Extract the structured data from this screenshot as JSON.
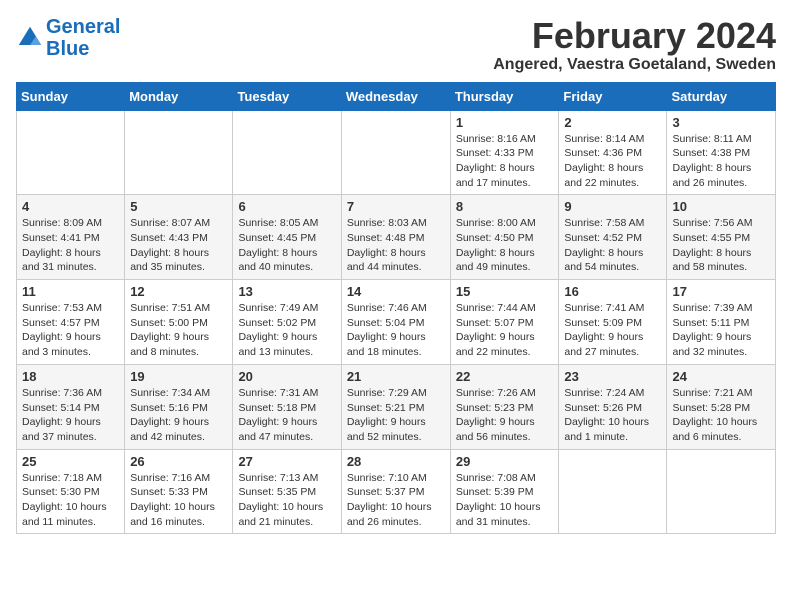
{
  "header": {
    "logo_general": "General",
    "logo_blue": "Blue",
    "month_title": "February 2024",
    "subtitle": "Angered, Vaestra Goetaland, Sweden"
  },
  "days_of_week": [
    "Sunday",
    "Monday",
    "Tuesday",
    "Wednesday",
    "Thursday",
    "Friday",
    "Saturday"
  ],
  "weeks": [
    [
      {
        "day": "",
        "content": ""
      },
      {
        "day": "",
        "content": ""
      },
      {
        "day": "",
        "content": ""
      },
      {
        "day": "",
        "content": ""
      },
      {
        "day": "1",
        "content": "Sunrise: 8:16 AM\nSunset: 4:33 PM\nDaylight: 8 hours\nand 17 minutes."
      },
      {
        "day": "2",
        "content": "Sunrise: 8:14 AM\nSunset: 4:36 PM\nDaylight: 8 hours\nand 22 minutes."
      },
      {
        "day": "3",
        "content": "Sunrise: 8:11 AM\nSunset: 4:38 PM\nDaylight: 8 hours\nand 26 minutes."
      }
    ],
    [
      {
        "day": "4",
        "content": "Sunrise: 8:09 AM\nSunset: 4:41 PM\nDaylight: 8 hours\nand 31 minutes."
      },
      {
        "day": "5",
        "content": "Sunrise: 8:07 AM\nSunset: 4:43 PM\nDaylight: 8 hours\nand 35 minutes."
      },
      {
        "day": "6",
        "content": "Sunrise: 8:05 AM\nSunset: 4:45 PM\nDaylight: 8 hours\nand 40 minutes."
      },
      {
        "day": "7",
        "content": "Sunrise: 8:03 AM\nSunset: 4:48 PM\nDaylight: 8 hours\nand 44 minutes."
      },
      {
        "day": "8",
        "content": "Sunrise: 8:00 AM\nSunset: 4:50 PM\nDaylight: 8 hours\nand 49 minutes."
      },
      {
        "day": "9",
        "content": "Sunrise: 7:58 AM\nSunset: 4:52 PM\nDaylight: 8 hours\nand 54 minutes."
      },
      {
        "day": "10",
        "content": "Sunrise: 7:56 AM\nSunset: 4:55 PM\nDaylight: 8 hours\nand 58 minutes."
      }
    ],
    [
      {
        "day": "11",
        "content": "Sunrise: 7:53 AM\nSunset: 4:57 PM\nDaylight: 9 hours\nand 3 minutes."
      },
      {
        "day": "12",
        "content": "Sunrise: 7:51 AM\nSunset: 5:00 PM\nDaylight: 9 hours\nand 8 minutes."
      },
      {
        "day": "13",
        "content": "Sunrise: 7:49 AM\nSunset: 5:02 PM\nDaylight: 9 hours\nand 13 minutes."
      },
      {
        "day": "14",
        "content": "Sunrise: 7:46 AM\nSunset: 5:04 PM\nDaylight: 9 hours\nand 18 minutes."
      },
      {
        "day": "15",
        "content": "Sunrise: 7:44 AM\nSunset: 5:07 PM\nDaylight: 9 hours\nand 22 minutes."
      },
      {
        "day": "16",
        "content": "Sunrise: 7:41 AM\nSunset: 5:09 PM\nDaylight: 9 hours\nand 27 minutes."
      },
      {
        "day": "17",
        "content": "Sunrise: 7:39 AM\nSunset: 5:11 PM\nDaylight: 9 hours\nand 32 minutes."
      }
    ],
    [
      {
        "day": "18",
        "content": "Sunrise: 7:36 AM\nSunset: 5:14 PM\nDaylight: 9 hours\nand 37 minutes."
      },
      {
        "day": "19",
        "content": "Sunrise: 7:34 AM\nSunset: 5:16 PM\nDaylight: 9 hours\nand 42 minutes."
      },
      {
        "day": "20",
        "content": "Sunrise: 7:31 AM\nSunset: 5:18 PM\nDaylight: 9 hours\nand 47 minutes."
      },
      {
        "day": "21",
        "content": "Sunrise: 7:29 AM\nSunset: 5:21 PM\nDaylight: 9 hours\nand 52 minutes."
      },
      {
        "day": "22",
        "content": "Sunrise: 7:26 AM\nSunset: 5:23 PM\nDaylight: 9 hours\nand 56 minutes."
      },
      {
        "day": "23",
        "content": "Sunrise: 7:24 AM\nSunset: 5:26 PM\nDaylight: 10 hours\nand 1 minute."
      },
      {
        "day": "24",
        "content": "Sunrise: 7:21 AM\nSunset: 5:28 PM\nDaylight: 10 hours\nand 6 minutes."
      }
    ],
    [
      {
        "day": "25",
        "content": "Sunrise: 7:18 AM\nSunset: 5:30 PM\nDaylight: 10 hours\nand 11 minutes."
      },
      {
        "day": "26",
        "content": "Sunrise: 7:16 AM\nSunset: 5:33 PM\nDaylight: 10 hours\nand 16 minutes."
      },
      {
        "day": "27",
        "content": "Sunrise: 7:13 AM\nSunset: 5:35 PM\nDaylight: 10 hours\nand 21 minutes."
      },
      {
        "day": "28",
        "content": "Sunrise: 7:10 AM\nSunset: 5:37 PM\nDaylight: 10 hours\nand 26 minutes."
      },
      {
        "day": "29",
        "content": "Sunrise: 7:08 AM\nSunset: 5:39 PM\nDaylight: 10 hours\nand 31 minutes."
      },
      {
        "day": "",
        "content": ""
      },
      {
        "day": "",
        "content": ""
      }
    ]
  ]
}
